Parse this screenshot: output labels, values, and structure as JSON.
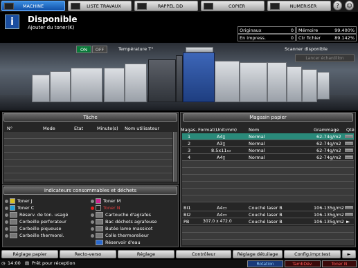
{
  "tabs": {
    "machine": "MACHINE",
    "jobs": "LISTE TRAVAUX",
    "recall": "RAPPEL DD",
    "copy": "COPIER",
    "scan": "NUMERISER"
  },
  "status": {
    "title": "Disponible",
    "subtitle": "Ajouter du toner(K)"
  },
  "counters": {
    "originals_label": "Originaux",
    "originals_value": "0",
    "memory_label": "Mémoire",
    "memory_value": "99.400%",
    "in_print_label": "En impress.",
    "in_print_value": "0",
    "file_label": "Ctr fichier",
    "file_value": "89.142%"
  },
  "machine": {
    "on_label": "ON",
    "off_label": "OFF",
    "temp_label": "Température T°",
    "scanner_label": "Scanner disponible",
    "calib_button": "Lancer échantillon"
  },
  "jobs_panel": {
    "title": "Tâche",
    "columns": [
      "N°",
      "Mode",
      "Etat",
      "Minute(s)",
      "Nom utilisateur"
    ]
  },
  "consumables": {
    "title": "Indicateurs consommables et déchets",
    "left": [
      "Toner J",
      "Toner C",
      "Réserv. de ton. usagé",
      "Corbeille perforateur",
      "Corbeille piqueuse",
      "Corbeille thermorel."
    ],
    "right": [
      "Toner M",
      "Toner N",
      "Cartouche d'agrafes",
      "Bac déchets agrafeuse",
      "Butée lame massicot",
      "Colle thermorelieur",
      "Réservoir d'eau"
    ]
  },
  "paper_panel": {
    "title": "Magasin papier",
    "columns": [
      "Magas.",
      "Format(Unit:mm)",
      "Nom",
      "Grammage",
      "Qté"
    ],
    "trays": [
      {
        "tray": "1",
        "size": "A4▯",
        "name": "Normal",
        "weight": "62-74g/m2"
      },
      {
        "tray": "2",
        "size": "A3▯",
        "name": "Normal",
        "weight": "62-74g/m2"
      },
      {
        "tray": "3",
        "size": "8.5x11▭",
        "name": "Normal",
        "weight": "62-74g/m2"
      },
      {
        "tray": "4",
        "size": "A4▯",
        "name": "Normal",
        "weight": "62-74g/m2"
      }
    ],
    "bypass": [
      {
        "tray": "BI1",
        "size": "A4▭",
        "name": "Couché laser B",
        "weight": "106-135g/m2"
      },
      {
        "tray": "BI2",
        "size": "A4▭",
        "name": "Couché laser B",
        "weight": "106-135g/m2"
      },
      {
        "tray": "PB",
        "size": "307.0 x 472.0",
        "name": "Couché laser B",
        "weight": "106-135g/m2"
      }
    ]
  },
  "bottom_buttons": [
    "Réglage papier",
    "Recto-verso",
    "Réglage",
    "Contrôleur",
    "Réglage détuilage",
    "Config.impr.test"
  ],
  "statusbar": {
    "time": "14:00",
    "message": "Prêt pour réception",
    "rotation": "Rotation",
    "tamb": "TambDév.",
    "toner": "Toner N"
  }
}
